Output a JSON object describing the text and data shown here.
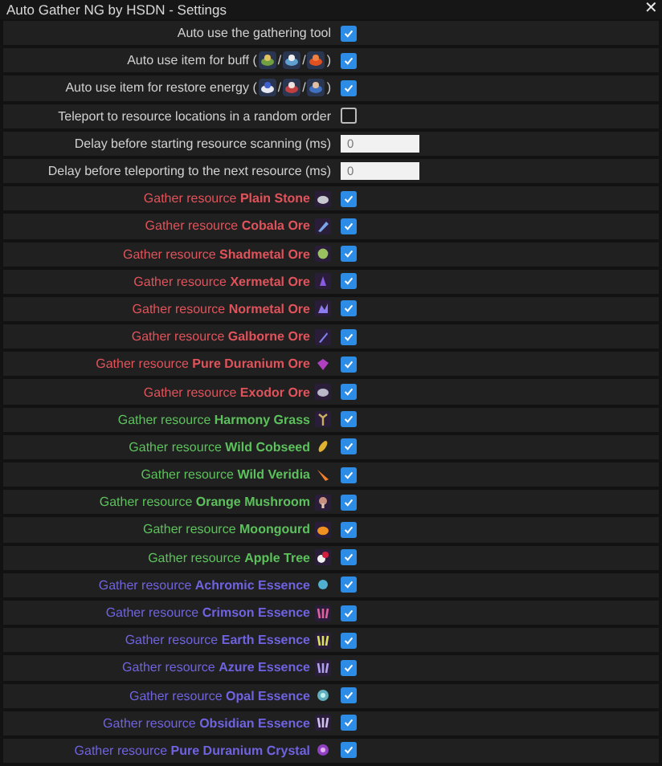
{
  "window": {
    "title": "Auto Gather NG by HSDN - Settings",
    "close": "✕"
  },
  "settings": [
    {
      "kind": "checkbox",
      "label_parts": [
        "Auto use the gathering tool"
      ],
      "checked": true
    },
    {
      "kind": "checkbox",
      "label_parts": [
        "Auto use item for buff (",
        "/",
        "/",
        ")"
      ],
      "checked": true
    },
    {
      "kind": "checkbox",
      "label_parts": [
        "Auto use item for restore energy (",
        "/",
        "/",
        ")"
      ],
      "checked": true
    },
    {
      "kind": "checkbox",
      "label_parts": [
        "Teleport to resource locations in a random order"
      ],
      "checked": false
    },
    {
      "kind": "number",
      "label_parts": [
        "Delay before starting resource scanning (ms)"
      ],
      "value": "0"
    },
    {
      "kind": "number",
      "label_parts": [
        "Delay before teleporting to the next resource (ms)"
      ],
      "value": "0"
    }
  ],
  "resources": [
    {
      "label": "Gather resource **Plain Stone**",
      "color": "#e0535b",
      "checked": true
    },
    {
      "label": "Gather resource **Cobala Ore**",
      "color": "#e0535b",
      "checked": true
    },
    {
      "label": "Gather resource **Shadmetal Ore**",
      "color": "#e0535b",
      "checked": true
    },
    {
      "label": "Gather resource **Xermetal Ore**",
      "color": "#e0535b",
      "checked": true
    },
    {
      "label": "Gather resource **Normetal Ore**",
      "color": "#e0535b",
      "checked": true
    },
    {
      "label": "Gather resource **Galborne Ore**",
      "color": "#e0535b",
      "checked": true
    },
    {
      "label": "Gather resource **Pure Duranium Ore**",
      "color": "#e0535b",
      "checked": true
    },
    {
      "label": "Gather resource **Exodor Ore**",
      "color": "#e0535b",
      "checked": true
    },
    {
      "label": "Gather resource **Harmony Grass**",
      "color": "#5cc05c",
      "checked": true
    },
    {
      "label": "Gather resource **Wild Cobseed**",
      "color": "#5cc05c",
      "checked": true
    },
    {
      "label": "Gather resource **Wild Veridia**",
      "color": "#5cc05c",
      "checked": true
    },
    {
      "label": "Gather resource **Orange Mushroom**",
      "color": "#5cc05c",
      "checked": true
    },
    {
      "label": "Gather resource **Moongourd**",
      "color": "#5cc05c",
      "checked": true
    },
    {
      "label": "Gather resource **Apple Tree**",
      "color": "#5cc05c",
      "checked": true
    },
    {
      "label": "Gather resource **Achromic Essence**",
      "color": "#6f63e0",
      "checked": true
    },
    {
      "label": "Gather resource **Crimson Essence**",
      "color": "#6f63e0",
      "checked": true
    },
    {
      "label": "Gather resource **Earth Essence**",
      "color": "#6f63e0",
      "checked": true
    },
    {
      "label": "Gather resource **Azure Essence**",
      "color": "#6f63e0",
      "checked": true
    },
    {
      "label": "Gather resource **Opal Essence**",
      "color": "#6f63e0",
      "checked": true
    },
    {
      "label": "Gather resource **Obsidian Essence**",
      "color": "#6f63e0",
      "checked": true
    },
    {
      "label": "Gather resource **Pure Duranium Crystal**",
      "color": "#6f63e0",
      "checked": true
    }
  ]
}
